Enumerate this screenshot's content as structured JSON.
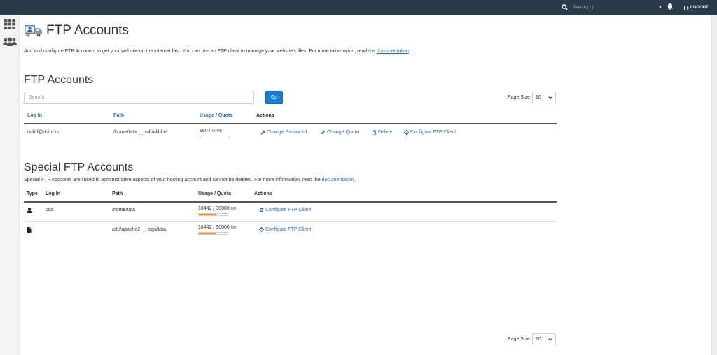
{
  "topbar": {
    "search_placeholder": "Search ( / )",
    "caret": "▼",
    "logout_label": "LOGOUT"
  },
  "page": {
    "title": "FTP Accounts",
    "intro_text": "Add and configure FTP Accounts to get your website on the internet fast. You can use an FTP client to manage your website's files. For more information, read the ",
    "intro_link": "documentation",
    "intro_end": "."
  },
  "ftp_accounts": {
    "heading": "FTP Accounts",
    "search_placeholder": "Search",
    "go_label": "Go",
    "page_size_label": "Page Size",
    "page_size_value": "10",
    "headers": {
      "login": "Log In",
      "path": "Path",
      "usage": "Usage",
      "slash": " / ",
      "quota": "Quota",
      "actions": "Actions"
    },
    "rows": [
      {
        "login": "ridibf@ridibf.rs",
        "path_start": "/home/tata",
        "path_dots": "…",
        "path_end": "ml/ridibf.rs",
        "usage": "880 / ∞",
        "unit": "MB",
        "usage_fraction": 0,
        "actions": {
          "change_password": "Change Password",
          "change_quota": "Change Quota",
          "delete": "Delete",
          "configure": "Configure FTP Client"
        }
      }
    ]
  },
  "special_accounts": {
    "heading": "Special FTP Accounts",
    "intro_text": "Special FTP Accounts are linked to administrative aspects of your hosting account and cannot be deleted. For more information, read the ",
    "intro_link": "documentation",
    "intro_end": ".",
    "headers": {
      "type": "Type",
      "login": "Log In",
      "path": "Path",
      "usage": "Usage / Quota",
      "actions": "Actions"
    },
    "rows": [
      {
        "type_icon": "user-icon",
        "login": "tata",
        "path_start": "/home/tata",
        "path_dots": "",
        "path_end": "",
        "usage": "18442 / 30000",
        "unit": "MB",
        "usage_fraction": 0.61,
        "configure": "Configure FTP Client"
      },
      {
        "type_icon": "file-icon",
        "login": "",
        "path_start": "/etc/apache2",
        "path_dots": "…",
        "path_end": "ogs/tata",
        "usage": "18442 / 30000",
        "unit": "MB",
        "usage_fraction": 0.61,
        "configure": "Configure FTP Client"
      }
    ]
  },
  "footer": {
    "page_size_label": "Page Size",
    "page_size_value": "10"
  },
  "colors": {
    "topbar": "#293a4a",
    "accent": "#1a7fd6",
    "link": "#2a6ab4",
    "usage_bar": "#f0932b"
  }
}
